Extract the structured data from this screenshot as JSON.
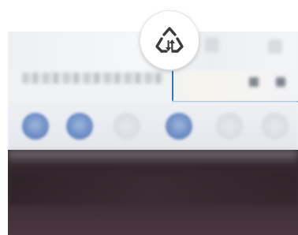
{
  "badge": {
    "icon": "recycle-sync-icon"
  },
  "colors": {
    "accent": "#2a7bbf",
    "button_blue": "#6f8fc6",
    "dark_area": "#3a2a31"
  }
}
